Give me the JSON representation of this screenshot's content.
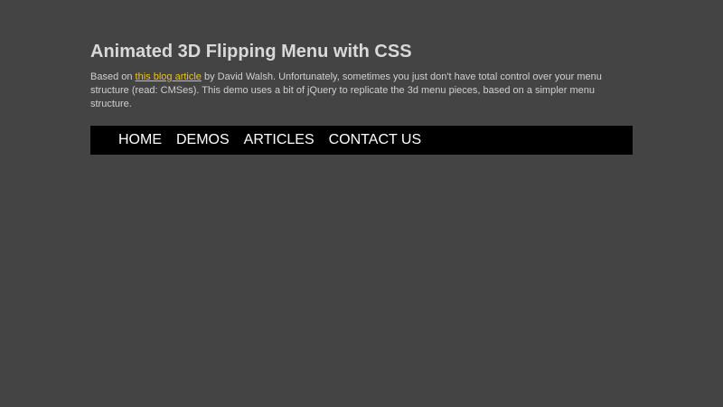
{
  "page": {
    "title": "Animated 3D Flipping Menu with CSS",
    "intro_prefix": "Based on ",
    "intro_link": "this blog article",
    "intro_suffix": " by David Walsh. Unfortunately, sometimes you just don't have total control over your menu structure (read: CMSes). This demo uses a bit of jQuery to replicate the 3d menu pieces, based on a simpler menu structure."
  },
  "menu": {
    "items": [
      {
        "label": "HOME"
      },
      {
        "label": "DEMOS"
      },
      {
        "label": "ARTICLES"
      },
      {
        "label": "CONTACT US"
      }
    ]
  },
  "colors": {
    "background": "#444444",
    "menu_background": "#000000",
    "link": "#f2c40a",
    "text": "#d0d0d0"
  }
}
